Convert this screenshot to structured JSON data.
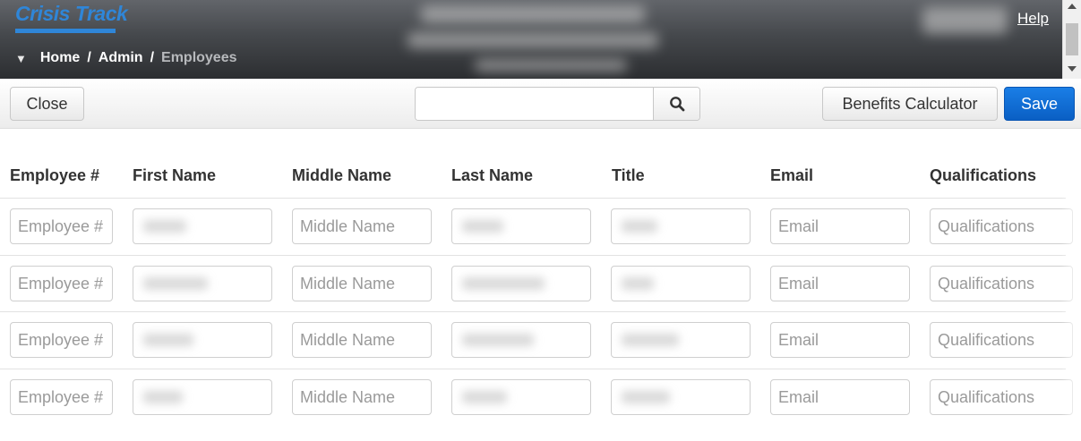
{
  "app": {
    "brand": "Crisis Track",
    "help_label": "Help"
  },
  "breadcrumb": {
    "items": [
      "Home",
      "Admin",
      "Employees"
    ],
    "separator": "/"
  },
  "toolbar": {
    "close_label": "Close",
    "search_value": "",
    "benefits_label": "Benefits Calculator",
    "save_label": "Save"
  },
  "table": {
    "headers": [
      "Employee #",
      "First Name",
      "Middle Name",
      "Last Name",
      "Title",
      "Email",
      "Qualifications"
    ],
    "placeholders": {
      "employee_number": "Employee #",
      "middle_name": "Middle Name",
      "email": "Email",
      "qualifications": "Qualifications"
    },
    "row_count": 4
  },
  "colors": {
    "accent": "#2f86d8",
    "save_button": "#0a66d0",
    "header_bg": "#45484c"
  }
}
